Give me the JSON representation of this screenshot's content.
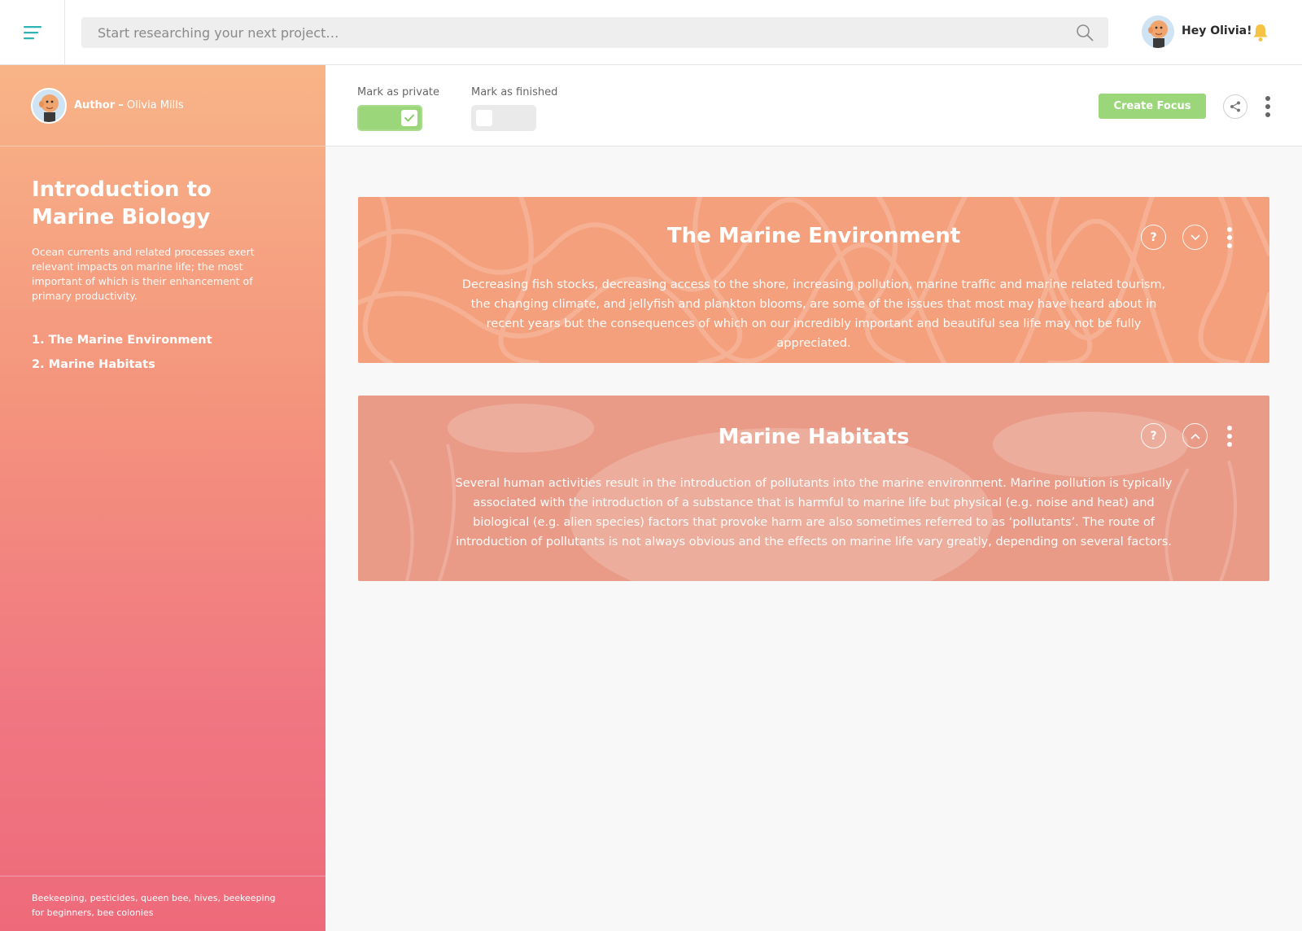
{
  "header": {
    "search_placeholder": "Start researching your next project…",
    "greeting": "Hey Olivia!"
  },
  "sidebar": {
    "author_label": "Author",
    "author_separator": "–",
    "author_name": "Olivia Mills",
    "title": "Introduction to Marine Biology",
    "description": "Ocean currents and related processes exert relevant impacts on marine life; the most important of which is their enhancement of primary productivity.",
    "nav": [
      {
        "label": "1. The Marine Environment"
      },
      {
        "label": "2. Marine Habitats"
      }
    ],
    "tags": "Beekeeping, pesticides, queen bee, hives, beekeeping for beginners, bee colonies"
  },
  "toolbar": {
    "private_label": "Mark as private",
    "private_on": true,
    "finished_label": "Mark as finished",
    "finished_on": false,
    "create_label": "Create Focus"
  },
  "cards": [
    {
      "title": "The Marine Environment",
      "body": "Decreasing fish stocks, decreasing access to the shore, increasing pollution, marine traffic and marine related tourism, the changing climate, and jellyfish and plankton blooms, are some of the issues that most may have heard about in recent years but the consequences of which on our incredibly important and beautiful sea life may not be fully appreciated.",
      "expand_icon": "chevron-down-icon"
    },
    {
      "title": "Marine Habitats",
      "body": "Several human activities result in the introduction of pollutants into the marine environment. Marine pollution is typically associated with the introduction of a substance that is harmful to marine life but physical (e.g. noise and heat) and biological (e.g. alien species) factors that provoke harm are also sometimes referred to as ‘pollutants’. The route of introduction of pollutants is not always obvious and the effects on marine life vary greatly, depending on several factors.",
      "expand_icon": "chevron-up-icon"
    }
  ],
  "colors": {
    "accent_teal": "#2fb4b4",
    "toggle_green": "#9bd77a",
    "bell_yellow": "#f5c242",
    "sidebar_top": "#f8b487",
    "sidebar_bottom": "#ee6a7a",
    "card1": "#f4a07d",
    "card2": "#ea9b88"
  }
}
